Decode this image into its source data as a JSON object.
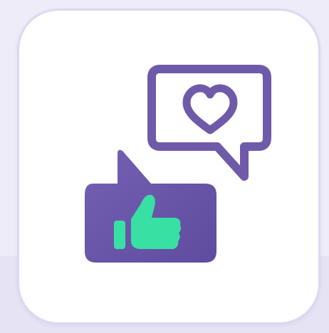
{
  "app_icon": {
    "icons": {
      "speech_bubble": "heart-speech-bubble-icon",
      "heart": "heart-icon",
      "like_bubble": "like-speech-bubble-icon",
      "thumb": "thumbs-up-icon"
    },
    "colors": {
      "page_background": "#eeecf8",
      "tile_background": "#ffffff",
      "tile_border": "#ddd8f2",
      "outline_purple": "#6f5aaa",
      "bubble_purple": "#6a55a8",
      "thumb_green": "#39e0a3"
    }
  }
}
